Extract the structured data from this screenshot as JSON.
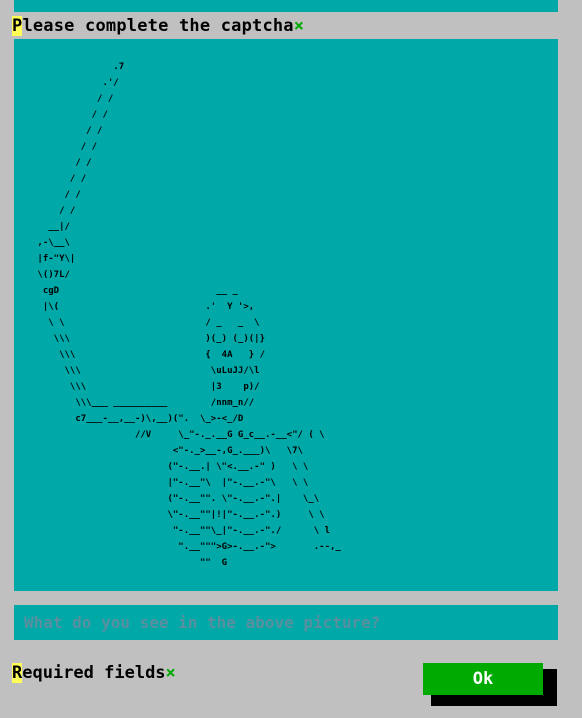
{
  "form": {
    "title_first_letter": "P",
    "title_rest": "lease complete the captcha",
    "required_marker": "×"
  },
  "captcha": {
    "art": "               .7\n             .'/\n            / /\n           / /\n          / /\n         / /\n        / /\n       / /\n      / /\n     / /\n   __|/\n ,-\\__\\\n |f-\"Y\\|\n \\()7L/\n  cgD                             __ _\n  |\\(                           .'  Y '>,\n   \\ \\                          / _   _  \\\n    \\\\\\                         )(_) (_)(|}\n     \\\\\\                        {  4A   } /\n      \\\\\\                        \\uLuJJ/\\l\n       \\\\\\                       |3    p)/\n        \\\\\\___ __________        /nnm_n//\n        c7___-__,__-)\\,__)(\".  \\_>-<_/D\n                   //V     \\_\"-._.__G G_c__.-__<\"/ ( \\\n                          <\"-._>__-,G_.___)\\   \\7\\\n                         (\"-.__.| \\\"<.__.-\" )   \\ \\\n                         |\"-.__\"\\  |\"-.__.-\"\\   \\ \\\n                         (\"-.__\"\". \\\"-.__.-\".|    \\_\\\n                         \\\"-.__\"\"|!|\"-.__.-\".)     \\ \\\n                          \"-.__\"\"\\_|\"-.__.-\"./      \\ l\n                           \".__\"\"\">G>-.__.-\">       .--,_\n                               \"\"  G"
  },
  "answer": {
    "placeholder": "What do you see in the above picture?"
  },
  "footer": {
    "required_first_letter": "R",
    "required_rest": "equired fields",
    "required_marker": "×"
  },
  "ok_button": {
    "label": "Ok"
  },
  "colors": {
    "background": "#c0c0c0",
    "panel": "#00a8a8",
    "button": "#00aa00",
    "highlight": "#ffff55",
    "required": "#00aa00"
  }
}
